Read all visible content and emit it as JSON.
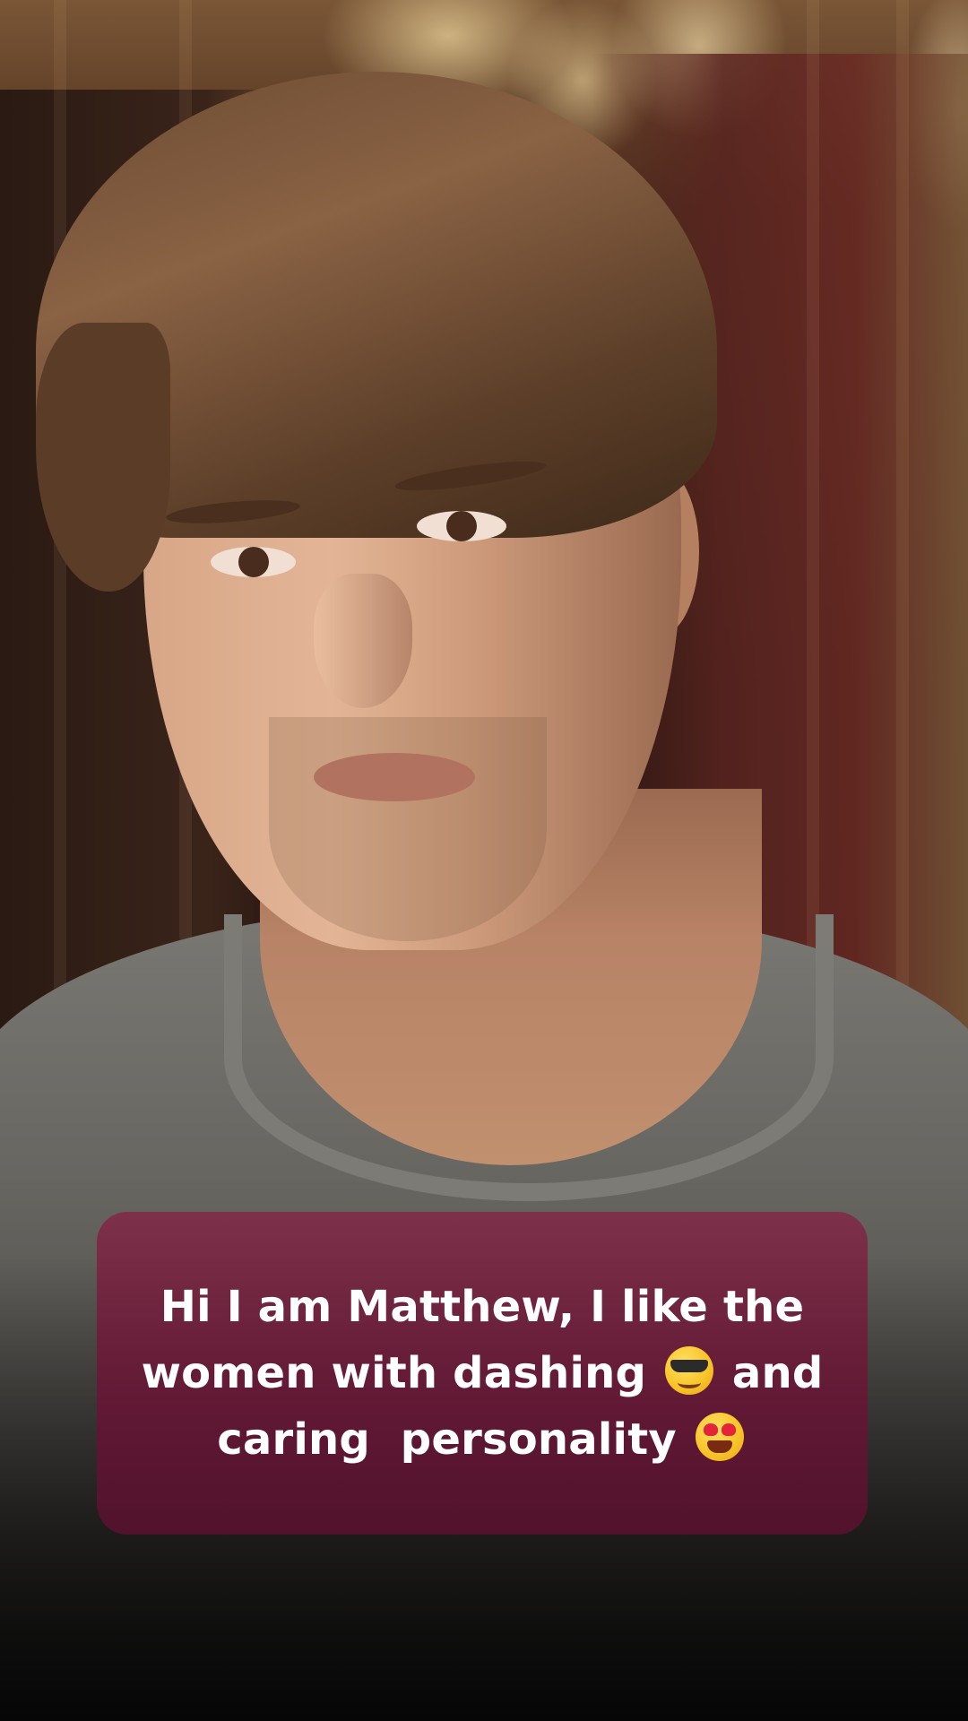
{
  "caption": {
    "line1": "Hi I am Matthew, I like the",
    "line2_text": "women with dashing",
    "line2_emoji": "smiling-face-with-sunglasses-icon",
    "line2_end": "and",
    "line3_text": "caring  personality",
    "line3_emoji": "smiling-face-with-heart-eyes-icon"
  },
  "colors": {
    "caption_card": "#6e1e40",
    "caption_text": "#ffffff"
  }
}
